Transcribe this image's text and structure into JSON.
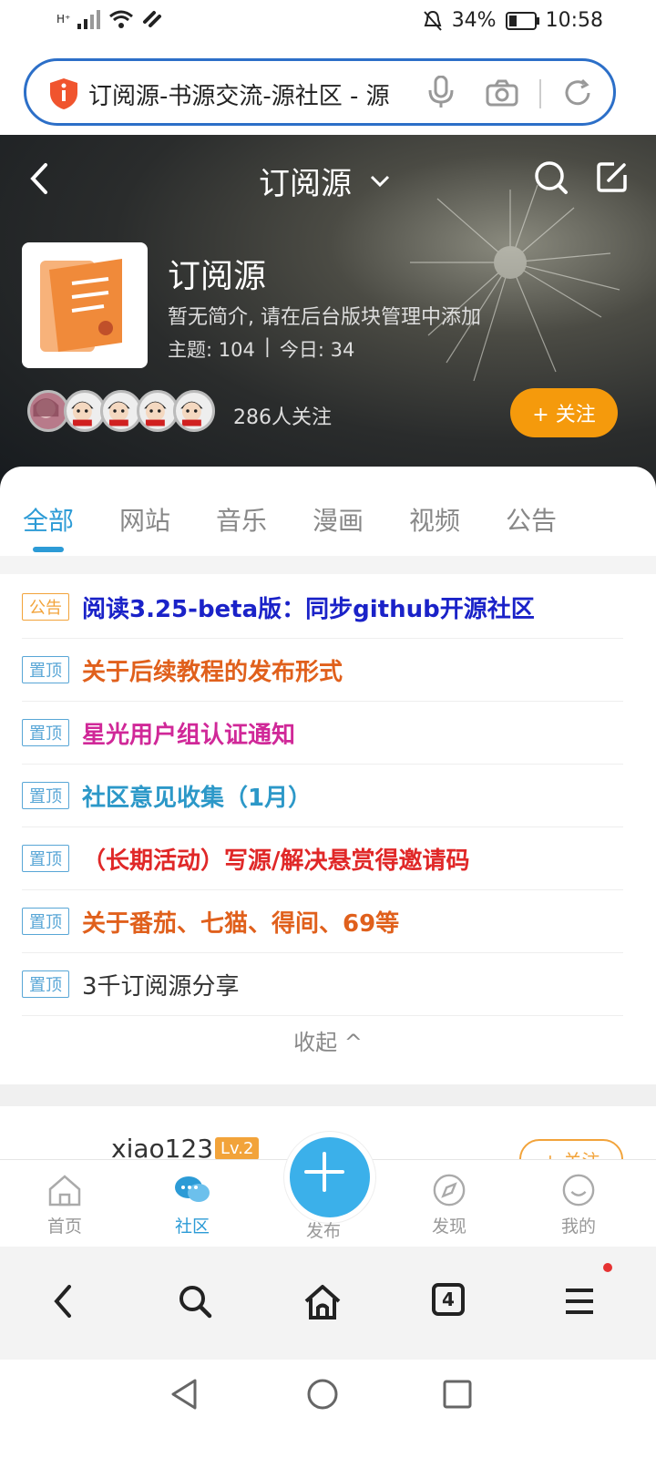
{
  "status_bar": {
    "network": "H⁺",
    "battery_pct": "34%",
    "battery_level": 0.34,
    "time": "10:58"
  },
  "browser": {
    "url_text": "订阅源-书源交流-源社区 - 源"
  },
  "hero": {
    "nav_title": "订阅源",
    "forum_name": "订阅源",
    "description": "暂无简介, 请在后台版块管理中添加",
    "topics_label": "主题: 104",
    "separator": "|",
    "today_label": "今日: 34",
    "followers": "286人关注",
    "follow_button": "+ 关注"
  },
  "tabs": [
    {
      "label": "全部",
      "active": true
    },
    {
      "label": "网站",
      "active": false
    },
    {
      "label": "音乐",
      "active": false
    },
    {
      "label": "漫画",
      "active": false
    },
    {
      "label": "视频",
      "active": false
    },
    {
      "label": "公告",
      "active": false
    }
  ],
  "pinned": [
    {
      "tag": "公告",
      "title": "阅读3.25-beta版：同步github开源社区",
      "color": "#1a22c8"
    },
    {
      "tag": "置顶",
      "title": "关于后续教程的发布形式",
      "color": "#e0601c"
    },
    {
      "tag": "置顶",
      "title": "星光用户组认证通知",
      "color": "#d02898"
    },
    {
      "tag": "置顶",
      "title": "社区意见收集（1月）",
      "color": "#2c98c8"
    },
    {
      "tag": "置顶",
      "title": "（长期活动）写源/解决悬赏得邀请码",
      "color": "#e02828"
    },
    {
      "tag": "置顶",
      "title": "关于番茄、七猫、得间、69等",
      "color": "#e0601c"
    },
    {
      "tag": "置顶",
      "title": "3千订阅源分享",
      "color": "#333333"
    }
  ],
  "collapse_label": "收起 ^",
  "post_peek": {
    "username": "xiao123",
    "level": "Lv.2",
    "follow": "+ 关注"
  },
  "app_nav": [
    {
      "label": "首页",
      "icon": "home-icon"
    },
    {
      "label": "社区",
      "icon": "community-icon"
    },
    {
      "label": "发布",
      "icon": "plus-icon"
    },
    {
      "label": "发现",
      "icon": "compass-icon"
    },
    {
      "label": "我的",
      "icon": "profile-icon"
    }
  ],
  "browser_toolbar": {
    "tab_count": "4"
  }
}
